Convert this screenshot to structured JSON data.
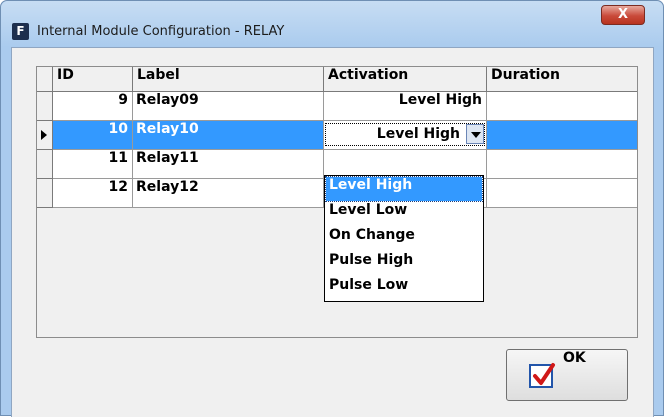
{
  "window": {
    "title": "Internal Module Configuration - RELAY",
    "app_icon_letter": "F",
    "close_glyph": "X"
  },
  "grid": {
    "columns": [
      "ID",
      "Label",
      "Activation",
      "Duration"
    ],
    "rows": [
      {
        "id": "9",
        "label": "Relay09",
        "activation": "Level High",
        "duration": ""
      },
      {
        "id": "10",
        "label": "Relay10",
        "activation": "Level High",
        "duration": ""
      },
      {
        "id": "11",
        "label": "Relay11",
        "activation": "",
        "duration": ""
      },
      {
        "id": "12",
        "label": "Relay12",
        "activation": "",
        "duration": ""
      }
    ],
    "selected_row": 1
  },
  "activation_dropdown": {
    "selected": "Level High",
    "options": [
      "Level High",
      "Level Low",
      "On Change",
      "Pulse High",
      "Pulse Low"
    ]
  },
  "ok_button": {
    "label": "OK",
    "icon": "checkbox-check-icon"
  },
  "colors": {
    "selection": "#3399ff",
    "title_bar": "#aacbee",
    "close_button": "#c94a3a"
  }
}
